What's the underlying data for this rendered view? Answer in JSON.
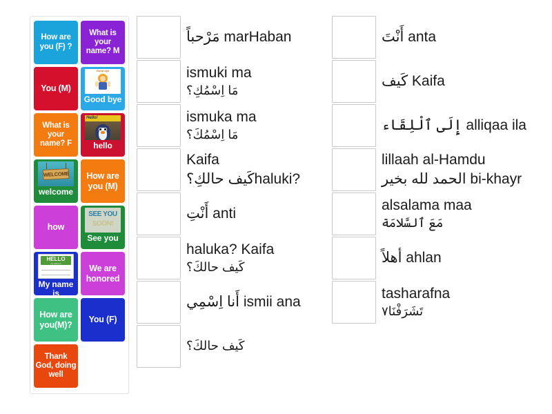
{
  "activity": {
    "type": "match-up-drag-and-drop",
    "title": "Arabic greetings match-up"
  },
  "tile_tray": {
    "name": "draggable-tiles",
    "tiles": [
      {
        "id": "tile-1",
        "label": "How are you (F) ?",
        "color": "#1ba3dc",
        "text_color": "#ffffff",
        "picture": null
      },
      {
        "id": "tile-2",
        "label": "What is your name? M",
        "color": "#8a22d6",
        "text_color": "#ffffff",
        "picture": null
      },
      {
        "id": "tile-3",
        "label": "You (M)",
        "color": "#d5102c",
        "text_color": "#ffffff",
        "picture": null
      },
      {
        "id": "tile-4",
        "label": "Good bye",
        "color": "#2ba8e8",
        "text_color": "#ffffff",
        "picture": "goodbye-illustration",
        "picture_caption": "Good bye"
      },
      {
        "id": "tile-5",
        "label": "What is your name? F",
        "color": "#f47b10",
        "text_color": "#ffffff",
        "picture": null
      },
      {
        "id": "tile-6",
        "label": "hello",
        "color": "#cc1030",
        "text_color": "#ffffff",
        "picture": "penguin-hello-illustration"
      },
      {
        "id": "tile-7",
        "label": "welcome",
        "color": "#1f8c3b",
        "text_color": "#ffffff",
        "picture": "welcome-sign-illustration"
      },
      {
        "id": "tile-8",
        "label": "How are you (M)",
        "color": "#f47b10",
        "text_color": "#ffffff",
        "picture": null
      },
      {
        "id": "tile-9",
        "label": "how",
        "color": "#cc3fd8",
        "text_color": "#ffffff",
        "picture": null
      },
      {
        "id": "tile-10",
        "label": "See you",
        "color": "#1f8c3b",
        "text_color": "#ffffff",
        "picture": "see-you-soon-illustration"
      },
      {
        "id": "tile-11",
        "label": "My name is",
        "color": "#1a2fcc",
        "text_color": "#ffffff",
        "picture": "hello-my-name-is-nametag"
      },
      {
        "id": "tile-12",
        "label": "We are honored",
        "color": "#cc3fd8",
        "text_color": "#ffffff",
        "picture": null
      },
      {
        "id": "tile-13",
        "label": "How are you(M)?",
        "color": "#3fc183",
        "text_color": "#ffffff",
        "picture": null
      },
      {
        "id": "tile-14",
        "label": "You (F)",
        "color": "#1a2fcc",
        "text_color": "#ffffff",
        "picture": null
      },
      {
        "id": "tile-15",
        "label": "Thank God, doing well",
        "color": "#e8470e",
        "text_color": "#ffffff",
        "picture": null
      }
    ]
  },
  "columns": {
    "middle": {
      "name": "answers-column-middle",
      "rows": [
        {
          "id": "mid-1",
          "lines": [
            {
              "text": "مَرْحباً marHaban",
              "dir": "mixed"
            }
          ]
        },
        {
          "id": "mid-2",
          "lines": [
            {
              "text": "ismuki ma",
              "dir": "ltr"
            },
            {
              "text": "مَا اِسْمُكِ؟",
              "dir": "rtl"
            }
          ]
        },
        {
          "id": "mid-3",
          "lines": [
            {
              "text": "ismuka ma",
              "dir": "ltr"
            },
            {
              "text": "مَا اِسْمُكَ؟",
              "dir": "rtl"
            }
          ]
        },
        {
          "id": "mid-4",
          "lines": [
            {
              "text": "Kaifa",
              "dir": "ltr"
            },
            {
              "text": "كَيف حالكِ؟haluki?",
              "dir": "mixed"
            }
          ]
        },
        {
          "id": "mid-5",
          "lines": [
            {
              "text": "أَنْتِ anti",
              "dir": "mixed"
            }
          ]
        },
        {
          "id": "mid-6",
          "lines": [
            {
              "text": "haluka? Kaifa",
              "dir": "ltr"
            },
            {
              "text": "كَيف حالكَ؟",
              "dir": "rtl"
            }
          ]
        },
        {
          "id": "mid-7",
          "lines": [
            {
              "text": "أَنا اِسْمِي ismii ana",
              "dir": "mixed"
            }
          ]
        },
        {
          "id": "mid-8",
          "lines": [
            {
              "text": "كَيف حالكَ؟",
              "dir": "rtl"
            }
          ]
        }
      ]
    },
    "right": {
      "name": "answers-column-right",
      "rows": [
        {
          "id": "right-1",
          "lines": [
            {
              "text": "أَنْتَ anta",
              "dir": "mixed"
            }
          ]
        },
        {
          "id": "right-2",
          "lines": [
            {
              "text": "كَيف Kaifa",
              "dir": "mixed"
            }
          ]
        },
        {
          "id": "right-3",
          "lines": [
            {
              "text": "إِلَى ٱلْلِقَاء alliqaa ila",
              "dir": "mixed"
            }
          ]
        },
        {
          "id": "right-4",
          "lines": [
            {
              "text": "lillaah al-Hamdu",
              "dir": "ltr"
            },
            {
              "text": "الحمد لله بخير bi-khayr",
              "dir": "mixed"
            }
          ]
        },
        {
          "id": "right-5",
          "lines": [
            {
              "text": "alsalama maa",
              "dir": "ltr"
            },
            {
              "text": "مَعَ ٱلسَّلامَة",
              "dir": "rtl"
            }
          ]
        },
        {
          "id": "right-6",
          "lines": [
            {
              "text": "أهلاً ahlan",
              "dir": "mixed"
            }
          ]
        },
        {
          "id": "right-7",
          "lines": [
            {
              "text": "tasharafna",
              "dir": "ltr"
            },
            {
              "text": "تَشَرَفْنَا٧",
              "dir": "rtl"
            }
          ]
        }
      ]
    }
  },
  "artwork_text": {
    "goodbye_title": "Good bye",
    "hello_banner": "Hello!",
    "welcome_sign": "WELCOME",
    "seeyou_line1": "SEE YOU",
    "seeyou_line2": "SOON!",
    "nametag_hello": "HELLO",
    "nametag_sub": "my name is"
  }
}
